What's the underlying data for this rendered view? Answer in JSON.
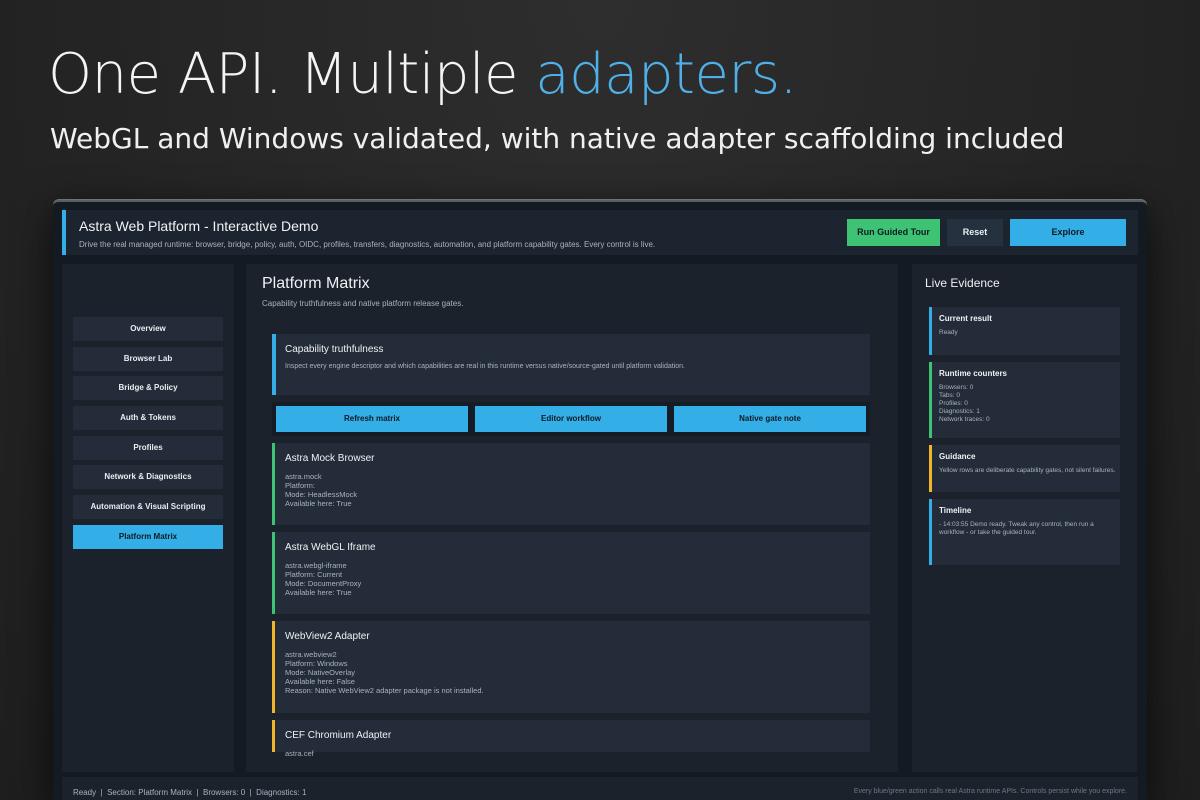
{
  "hero": {
    "title_main": "One API. Multiple ",
    "title_accent": "adapters.",
    "subtitle": "WebGL and Windows validated, with native adapter scaffolding included"
  },
  "header": {
    "title": "Astra Web Platform - Interactive Demo",
    "description": "Drive the real managed runtime: browser, bridge, policy, auth, OIDC, profiles, transfers, diagnostics, automation, and platform capability gates. Every control is live.",
    "run_tour": "Run Guided Tour",
    "reset": "Reset",
    "explore": "Explore"
  },
  "sidebar": {
    "items": [
      {
        "label": "Overview"
      },
      {
        "label": "Browser Lab"
      },
      {
        "label": "Bridge & Policy"
      },
      {
        "label": "Auth & Tokens"
      },
      {
        "label": "Profiles"
      },
      {
        "label": "Network & Diagnostics"
      },
      {
        "label": "Automation & Visual Scripting"
      },
      {
        "label": "Platform Matrix"
      }
    ],
    "active": "Platform Matrix"
  },
  "main": {
    "title": "Platform Matrix",
    "subtitle": "Capability truthfulness and native platform release gates.",
    "intro_card": {
      "title": "Capability truthfulness",
      "description": "Inspect every engine descriptor and which capabilities are real in this runtime versus native/source-gated until platform validation."
    },
    "actions": [
      "Refresh matrix",
      "Editor workflow",
      "Native gate note"
    ],
    "engines": [
      {
        "name": "Astra Mock Browser",
        "status": "ok",
        "lines": [
          "astra.mock",
          "Platform:",
          "Mode: HeadlessMock",
          "Available here: True"
        ]
      },
      {
        "name": "Astra WebGL Iframe",
        "status": "ok",
        "lines": [
          "astra.webgl-iframe",
          "Platform: Current",
          "Mode: DocumentProxy",
          "Available here: True"
        ]
      },
      {
        "name": "WebView2 Adapter",
        "status": "warn",
        "lines": [
          "astra.webview2",
          "Platform: Windows",
          "Mode: NativeOverlay",
          "Available here: False",
          "Reason: Native WebView2 adapter package is not installed."
        ]
      },
      {
        "name": "CEF Chromium Adapter",
        "status": "warn",
        "lines": [
          "astra.cef"
        ]
      }
    ]
  },
  "evidence": {
    "title": "Live Evidence",
    "cards": [
      {
        "title": "Current result",
        "text": "Ready",
        "color": "blue"
      },
      {
        "title": "Runtime counters",
        "text": "Browsers: 0\nTabs: 0\nProfiles: 0\nDiagnostics: 1\nNetwork traces: 0",
        "color": "green"
      },
      {
        "title": "Guidance",
        "text": "Yellow rows are deliberate capability gates, not silent failures.",
        "color": "yellow"
      },
      {
        "title": "Timeline",
        "text": "- 14:03:55 Demo ready. Tweak any control, then run a workflow - or take the guided tour.",
        "color": "blue"
      }
    ]
  },
  "status": {
    "left": "Ready  |  Section: Platform Matrix  |  Browsers: 0  |  Diagnostics: 1",
    "right": "Every blue/green action calls real Astra runtime APIs. Controls persist while you explore."
  },
  "colors": {
    "accent_blue": "#33aee6",
    "accent_green": "#3ec374",
    "accent_yellow": "#f1b52c",
    "hero_accent": "#4fb0e8"
  }
}
